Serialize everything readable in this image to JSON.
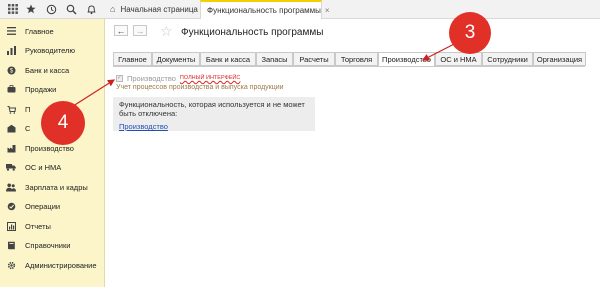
{
  "topbar": {
    "icons": [
      "apps-grid-icon",
      "star-icon",
      "history-icon",
      "search-icon",
      "bell-icon"
    ],
    "home_tab": "Начальная страница",
    "active_tab": "Функциональность программы",
    "close_glyph": "×"
  },
  "sidebar": {
    "items": [
      {
        "label": "Главное",
        "icon": "hamburger-icon"
      },
      {
        "label": "Руководителю",
        "icon": "chart-icon"
      },
      {
        "label": "Банк и касса",
        "icon": "wallet-icon"
      },
      {
        "label": "Продажи",
        "icon": "cart-icon"
      },
      {
        "label": "П",
        "icon": "purchase-icon"
      },
      {
        "label": "С",
        "icon": "warehouse-icon"
      },
      {
        "label": "Производство",
        "icon": "production-icon"
      },
      {
        "label": "ОС и НМА",
        "icon": "truck-icon"
      },
      {
        "label": "Зарплата и кадры",
        "icon": "people-icon"
      },
      {
        "label": "Операции",
        "icon": "operations-icon"
      },
      {
        "label": "Отчеты",
        "icon": "reports-icon"
      },
      {
        "label": "Справочники",
        "icon": "book-icon"
      },
      {
        "label": "Администрирование",
        "icon": "gear-icon"
      }
    ]
  },
  "main": {
    "back_glyph": "←",
    "forward_glyph": "→",
    "star_glyph": "☆",
    "title": "Функциональность программы",
    "tabs": [
      {
        "label": "Главное",
        "selected": false
      },
      {
        "label": "Документы",
        "selected": false
      },
      {
        "label": "Банк и касса",
        "selected": false
      },
      {
        "label": "Запасы",
        "selected": false
      },
      {
        "label": "Расчеты",
        "selected": false
      },
      {
        "label": "Торговля",
        "selected": false
      },
      {
        "label": "Производство",
        "selected": true
      },
      {
        "label": "ОС и НМА",
        "selected": false
      },
      {
        "label": "Сотрудники",
        "selected": false
      },
      {
        "label": "Организация",
        "selected": false
      }
    ],
    "checkbox": {
      "label": "Производство",
      "checked": true,
      "badge": "ПОЛНЫЙ ИНТЕРФЕЙС",
      "check_glyph": "✓"
    },
    "description": "Учет процессов производства и выпуска продукции",
    "info": {
      "text": "Функциональность, которая используется и не может быть отключена:",
      "link": "Производство"
    }
  },
  "annotations": [
    {
      "label": "3",
      "color": "#e03028"
    },
    {
      "label": "4",
      "color": "#e03028"
    }
  ]
}
